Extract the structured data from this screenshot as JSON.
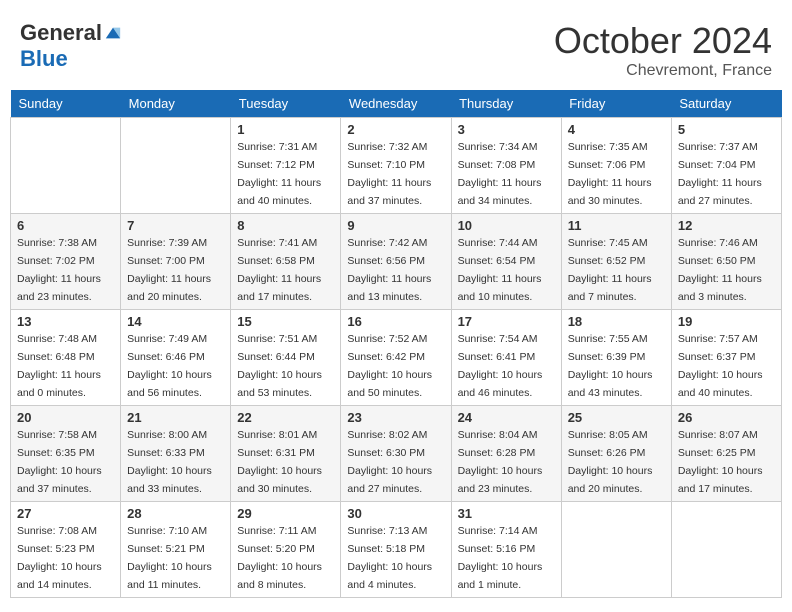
{
  "header": {
    "logo_general": "General",
    "logo_blue": "Blue",
    "month": "October 2024",
    "location": "Chevremont, France"
  },
  "days_of_week": [
    "Sunday",
    "Monday",
    "Tuesday",
    "Wednesday",
    "Thursday",
    "Friday",
    "Saturday"
  ],
  "weeks": [
    [
      {
        "day": "",
        "sunrise": "",
        "sunset": "",
        "daylight": ""
      },
      {
        "day": "",
        "sunrise": "",
        "sunset": "",
        "daylight": ""
      },
      {
        "day": "1",
        "sunrise": "Sunrise: 7:31 AM",
        "sunset": "Sunset: 7:12 PM",
        "daylight": "Daylight: 11 hours and 40 minutes."
      },
      {
        "day": "2",
        "sunrise": "Sunrise: 7:32 AM",
        "sunset": "Sunset: 7:10 PM",
        "daylight": "Daylight: 11 hours and 37 minutes."
      },
      {
        "day": "3",
        "sunrise": "Sunrise: 7:34 AM",
        "sunset": "Sunset: 7:08 PM",
        "daylight": "Daylight: 11 hours and 34 minutes."
      },
      {
        "day": "4",
        "sunrise": "Sunrise: 7:35 AM",
        "sunset": "Sunset: 7:06 PM",
        "daylight": "Daylight: 11 hours and 30 minutes."
      },
      {
        "day": "5",
        "sunrise": "Sunrise: 7:37 AM",
        "sunset": "Sunset: 7:04 PM",
        "daylight": "Daylight: 11 hours and 27 minutes."
      }
    ],
    [
      {
        "day": "6",
        "sunrise": "Sunrise: 7:38 AM",
        "sunset": "Sunset: 7:02 PM",
        "daylight": "Daylight: 11 hours and 23 minutes."
      },
      {
        "day": "7",
        "sunrise": "Sunrise: 7:39 AM",
        "sunset": "Sunset: 7:00 PM",
        "daylight": "Daylight: 11 hours and 20 minutes."
      },
      {
        "day": "8",
        "sunrise": "Sunrise: 7:41 AM",
        "sunset": "Sunset: 6:58 PM",
        "daylight": "Daylight: 11 hours and 17 minutes."
      },
      {
        "day": "9",
        "sunrise": "Sunrise: 7:42 AM",
        "sunset": "Sunset: 6:56 PM",
        "daylight": "Daylight: 11 hours and 13 minutes."
      },
      {
        "day": "10",
        "sunrise": "Sunrise: 7:44 AM",
        "sunset": "Sunset: 6:54 PM",
        "daylight": "Daylight: 11 hours and 10 minutes."
      },
      {
        "day": "11",
        "sunrise": "Sunrise: 7:45 AM",
        "sunset": "Sunset: 6:52 PM",
        "daylight": "Daylight: 11 hours and 7 minutes."
      },
      {
        "day": "12",
        "sunrise": "Sunrise: 7:46 AM",
        "sunset": "Sunset: 6:50 PM",
        "daylight": "Daylight: 11 hours and 3 minutes."
      }
    ],
    [
      {
        "day": "13",
        "sunrise": "Sunrise: 7:48 AM",
        "sunset": "Sunset: 6:48 PM",
        "daylight": "Daylight: 11 hours and 0 minutes."
      },
      {
        "day": "14",
        "sunrise": "Sunrise: 7:49 AM",
        "sunset": "Sunset: 6:46 PM",
        "daylight": "Daylight: 10 hours and 56 minutes."
      },
      {
        "day": "15",
        "sunrise": "Sunrise: 7:51 AM",
        "sunset": "Sunset: 6:44 PM",
        "daylight": "Daylight: 10 hours and 53 minutes."
      },
      {
        "day": "16",
        "sunrise": "Sunrise: 7:52 AM",
        "sunset": "Sunset: 6:42 PM",
        "daylight": "Daylight: 10 hours and 50 minutes."
      },
      {
        "day": "17",
        "sunrise": "Sunrise: 7:54 AM",
        "sunset": "Sunset: 6:41 PM",
        "daylight": "Daylight: 10 hours and 46 minutes."
      },
      {
        "day": "18",
        "sunrise": "Sunrise: 7:55 AM",
        "sunset": "Sunset: 6:39 PM",
        "daylight": "Daylight: 10 hours and 43 minutes."
      },
      {
        "day": "19",
        "sunrise": "Sunrise: 7:57 AM",
        "sunset": "Sunset: 6:37 PM",
        "daylight": "Daylight: 10 hours and 40 minutes."
      }
    ],
    [
      {
        "day": "20",
        "sunrise": "Sunrise: 7:58 AM",
        "sunset": "Sunset: 6:35 PM",
        "daylight": "Daylight: 10 hours and 37 minutes."
      },
      {
        "day": "21",
        "sunrise": "Sunrise: 8:00 AM",
        "sunset": "Sunset: 6:33 PM",
        "daylight": "Daylight: 10 hours and 33 minutes."
      },
      {
        "day": "22",
        "sunrise": "Sunrise: 8:01 AM",
        "sunset": "Sunset: 6:31 PM",
        "daylight": "Daylight: 10 hours and 30 minutes."
      },
      {
        "day": "23",
        "sunrise": "Sunrise: 8:02 AM",
        "sunset": "Sunset: 6:30 PM",
        "daylight": "Daylight: 10 hours and 27 minutes."
      },
      {
        "day": "24",
        "sunrise": "Sunrise: 8:04 AM",
        "sunset": "Sunset: 6:28 PM",
        "daylight": "Daylight: 10 hours and 23 minutes."
      },
      {
        "day": "25",
        "sunrise": "Sunrise: 8:05 AM",
        "sunset": "Sunset: 6:26 PM",
        "daylight": "Daylight: 10 hours and 20 minutes."
      },
      {
        "day": "26",
        "sunrise": "Sunrise: 8:07 AM",
        "sunset": "Sunset: 6:25 PM",
        "daylight": "Daylight: 10 hours and 17 minutes."
      }
    ],
    [
      {
        "day": "27",
        "sunrise": "Sunrise: 7:08 AM",
        "sunset": "Sunset: 5:23 PM",
        "daylight": "Daylight: 10 hours and 14 minutes."
      },
      {
        "day": "28",
        "sunrise": "Sunrise: 7:10 AM",
        "sunset": "Sunset: 5:21 PM",
        "daylight": "Daylight: 10 hours and 11 minutes."
      },
      {
        "day": "29",
        "sunrise": "Sunrise: 7:11 AM",
        "sunset": "Sunset: 5:20 PM",
        "daylight": "Daylight: 10 hours and 8 minutes."
      },
      {
        "day": "30",
        "sunrise": "Sunrise: 7:13 AM",
        "sunset": "Sunset: 5:18 PM",
        "daylight": "Daylight: 10 hours and 4 minutes."
      },
      {
        "day": "31",
        "sunrise": "Sunrise: 7:14 AM",
        "sunset": "Sunset: 5:16 PM",
        "daylight": "Daylight: 10 hours and 1 minute."
      },
      {
        "day": "",
        "sunrise": "",
        "sunset": "",
        "daylight": ""
      },
      {
        "day": "",
        "sunrise": "",
        "sunset": "",
        "daylight": ""
      }
    ]
  ]
}
